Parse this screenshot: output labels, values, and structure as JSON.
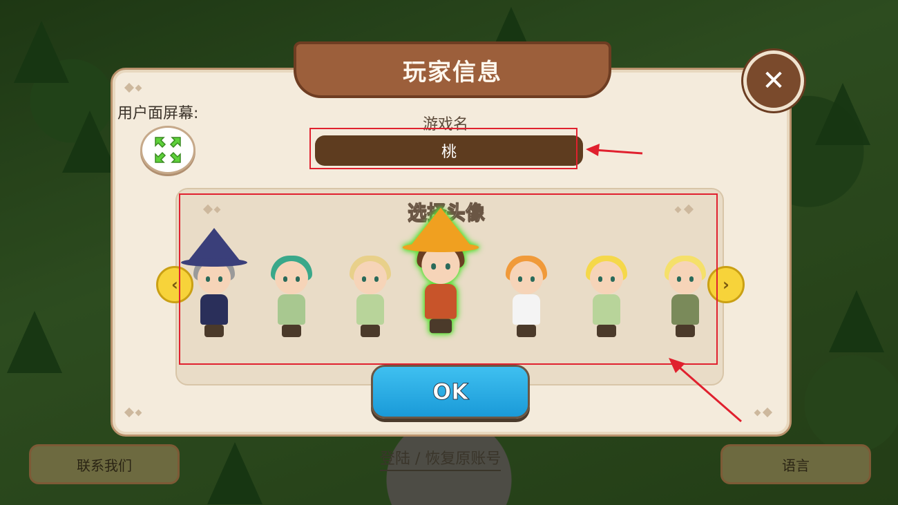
{
  "dialog": {
    "title": "玩家信息",
    "close_symbol": "✕",
    "fullscreen_label": "用户面屏幕:",
    "name_label": "游戏名",
    "name_value": "桃",
    "avatar_title": "选择头像",
    "ok_label": "OK",
    "prev_symbol": "‹",
    "next_symbol": "›",
    "avatars": [
      {
        "name": "wizard-grey-hair",
        "hair": "#9a9a9a",
        "body": "#2a2f5a",
        "hat": "#3a3f7a"
      },
      {
        "name": "elf-teal-hair",
        "hair": "#3aa88a",
        "body": "#a8c890"
      },
      {
        "name": "elf-blond-boy",
        "hair": "#e8d08a",
        "body": "#b8d49a"
      },
      {
        "name": "witch-orange-hat",
        "hair": "#6a3e22",
        "body": "#c8542a",
        "hat": "#f0a020",
        "selected": true
      },
      {
        "name": "girl-orange-hair",
        "hair": "#f09a3a",
        "body": "#f4f4f4"
      },
      {
        "name": "elf-yellow-hair-boy",
        "hair": "#f5d84a",
        "body": "#b8d49a"
      },
      {
        "name": "elf-yellow-hair-girl",
        "hair": "#f5e06a",
        "body": "#7a8a5a"
      }
    ]
  },
  "bottom": {
    "contact_label": "联系我们",
    "login_label": "登陆 / 恢复原账号",
    "language_label": "语言"
  },
  "colors": {
    "panel_bg": "#f4ebdc",
    "banner": "#9c5f3b",
    "ok_button": "#2aaee8",
    "highlight": "#e0202e"
  }
}
